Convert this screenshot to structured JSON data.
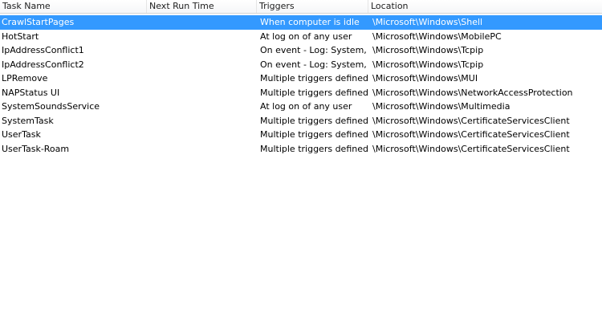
{
  "columns": [
    "Task Name",
    "Next Run Time",
    "Triggers",
    "Location"
  ],
  "rows": [
    {
      "name": "CrawlStartPages",
      "next_run": "",
      "triggers": "When computer is idle",
      "location": "\\Microsoft\\Windows\\Shell",
      "selected": true
    },
    {
      "name": "HotStart",
      "next_run": "",
      "triggers": "At log on of any user",
      "location": "\\Microsoft\\Windows\\MobilePC",
      "selected": false
    },
    {
      "name": "IpAddressConflict1",
      "next_run": "",
      "triggers": "On event - Log: System, ...",
      "location": "\\Microsoft\\Windows\\Tcpip",
      "selected": false
    },
    {
      "name": "IpAddressConflict2",
      "next_run": "",
      "triggers": "On event - Log: System, ...",
      "location": "\\Microsoft\\Windows\\Tcpip",
      "selected": false
    },
    {
      "name": "LPRemove",
      "next_run": "",
      "triggers": "Multiple triggers defined",
      "location": "\\Microsoft\\Windows\\MUI",
      "selected": false
    },
    {
      "name": "NAPStatus UI",
      "next_run": "",
      "triggers": "Multiple triggers defined",
      "location": "\\Microsoft\\Windows\\NetworkAccessProtection",
      "selected": false
    },
    {
      "name": "SystemSoundsService",
      "next_run": "",
      "triggers": "At log on of any user",
      "location": "\\Microsoft\\Windows\\Multimedia",
      "selected": false
    },
    {
      "name": "SystemTask",
      "next_run": "",
      "triggers": "Multiple triggers defined",
      "location": "\\Microsoft\\Windows\\CertificateServicesClient",
      "selected": false
    },
    {
      "name": "UserTask",
      "next_run": "",
      "triggers": "Multiple triggers defined",
      "location": "\\Microsoft\\Windows\\CertificateServicesClient",
      "selected": false
    },
    {
      "name": "UserTask-Roam",
      "next_run": "",
      "triggers": "Multiple triggers defined",
      "location": "\\Microsoft\\Windows\\CertificateServicesClient",
      "selected": false
    }
  ],
  "colors": {
    "selection": "#3399ff",
    "background": "#ffffff"
  }
}
